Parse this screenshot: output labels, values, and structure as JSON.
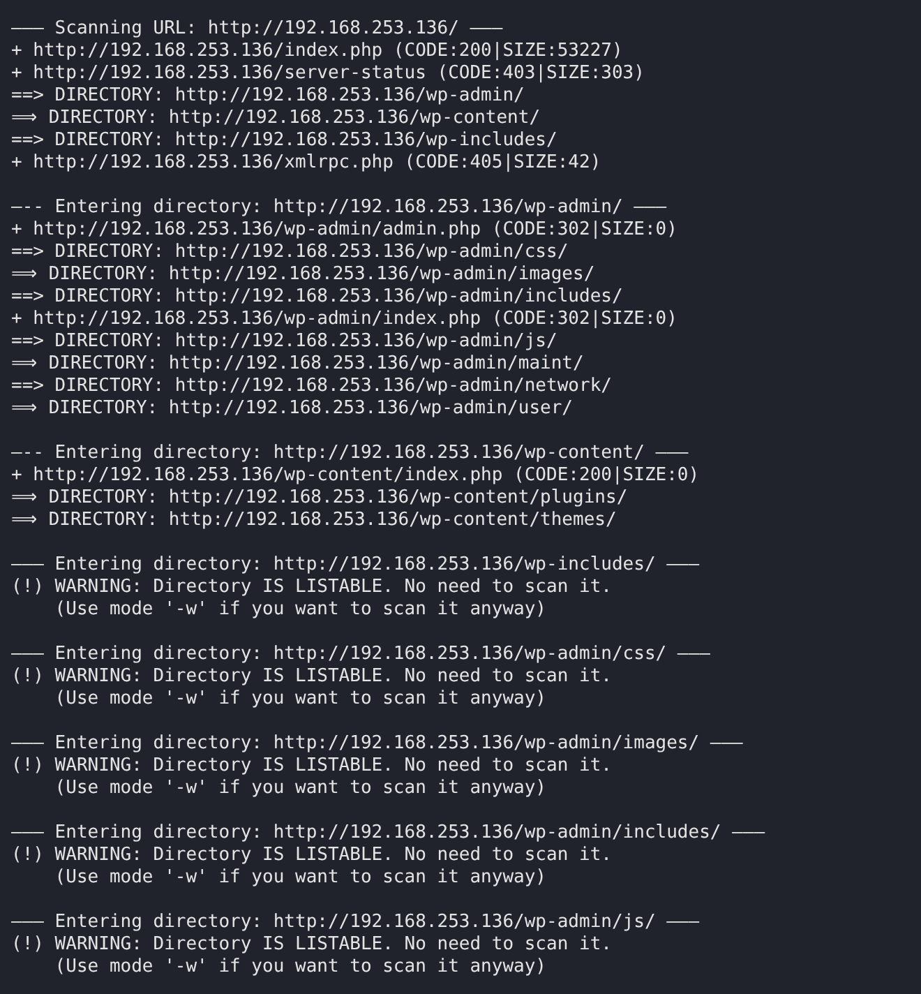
{
  "terminal": {
    "blocks": [
      {
        "lines": [
          "——— Scanning URL: http://192.168.253.136/ ———",
          "+ http://192.168.253.136/index.php (CODE:200|SIZE:53227)",
          "+ http://192.168.253.136/server-status (CODE:403|SIZE:303)",
          "==> DIRECTORY: http://192.168.253.136/wp-admin/",
          "⟹ DIRECTORY: http://192.168.253.136/wp-content/",
          "==> DIRECTORY: http://192.168.253.136/wp-includes/",
          "+ http://192.168.253.136/xmlrpc.php (CODE:405|SIZE:42)"
        ]
      },
      {
        "lines": [
          "—-- Entering directory: http://192.168.253.136/wp-admin/ ———",
          "+ http://192.168.253.136/wp-admin/admin.php (CODE:302|SIZE:0)",
          "==> DIRECTORY: http://192.168.253.136/wp-admin/css/",
          "⟹ DIRECTORY: http://192.168.253.136/wp-admin/images/",
          "==> DIRECTORY: http://192.168.253.136/wp-admin/includes/",
          "+ http://192.168.253.136/wp-admin/index.php (CODE:302|SIZE:0)",
          "==> DIRECTORY: http://192.168.253.136/wp-admin/js/",
          "⟹ DIRECTORY: http://192.168.253.136/wp-admin/maint/",
          "==> DIRECTORY: http://192.168.253.136/wp-admin/network/",
          "⟹ DIRECTORY: http://192.168.253.136/wp-admin/user/"
        ]
      },
      {
        "lines": [
          "—-- Entering directory: http://192.168.253.136/wp-content/ ———",
          "+ http://192.168.253.136/wp-content/index.php (CODE:200|SIZE:0)",
          "⟹ DIRECTORY: http://192.168.253.136/wp-content/plugins/",
          "⟹ DIRECTORY: http://192.168.253.136/wp-content/themes/"
        ]
      },
      {
        "lines": [
          "——— Entering directory: http://192.168.253.136/wp-includes/ ———",
          "(!) WARNING: Directory IS LISTABLE. No need to scan it.",
          "    (Use mode '-w' if you want to scan it anyway)"
        ]
      },
      {
        "lines": [
          "——— Entering directory: http://192.168.253.136/wp-admin/css/ ———",
          "(!) WARNING: Directory IS LISTABLE. No need to scan it.",
          "    (Use mode '-w' if you want to scan it anyway)"
        ]
      },
      {
        "lines": [
          "——— Entering directory: http://192.168.253.136/wp-admin/images/ ———",
          "(!) WARNING: Directory IS LISTABLE. No need to scan it.",
          "    (Use mode '-w' if you want to scan it anyway)"
        ]
      },
      {
        "lines": [
          "——— Entering directory: http://192.168.253.136/wp-admin/includes/ ———",
          "(!) WARNING: Directory IS LISTABLE. No need to scan it.",
          "    (Use mode '-w' if you want to scan it anyway)"
        ]
      },
      {
        "lines": [
          "——— Entering directory: http://192.168.253.136/wp-admin/js/ ———",
          "(!) WARNING: Directory IS LISTABLE. No need to scan it.",
          "    (Use mode '-w' if you want to scan it anyway)"
        ]
      }
    ]
  }
}
